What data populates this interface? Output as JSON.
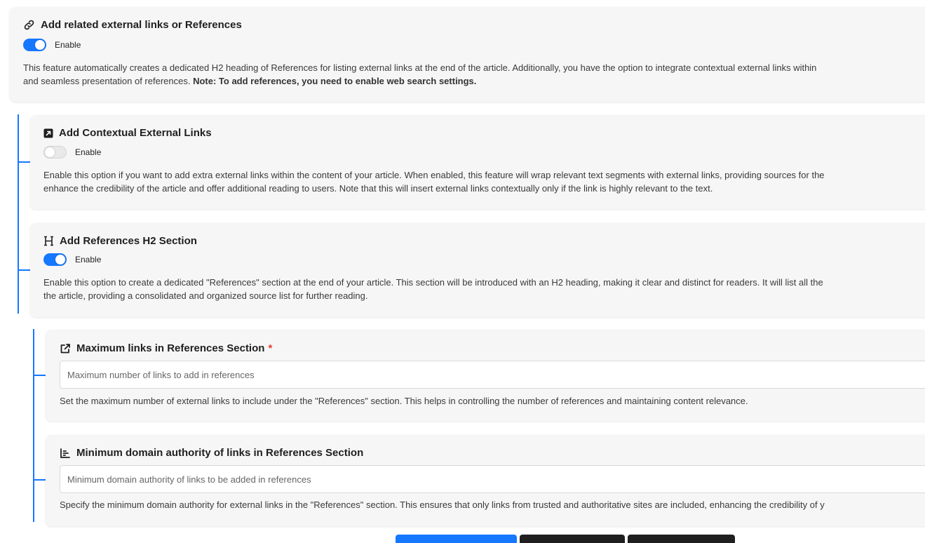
{
  "sections": {
    "external_links": {
      "title": "Add related external links or References",
      "toggle_label": "Enable",
      "enabled": true,
      "description": "This feature automatically creates a dedicated H2 heading of References for listing external links at the end of the article. Additionally, you have the option to integrate contextual external links within",
      "description_line2": "and seamless presentation of references.",
      "note": "Note: To add references, you need to enable web search settings."
    },
    "contextual": {
      "title": "Add Contextual External Links",
      "toggle_label": "Enable",
      "enabled": false,
      "description_line1": "Enable this option if you want to add extra external links within the content of your article. When enabled, this feature will wrap relevant text segments with external links, providing sources for the",
      "description_line2": "enhance the credibility of the article and offer additional reading to users. Note that this will insert external links contextually only if the link is highly relevant to the text."
    },
    "references_h2": {
      "title": "Add References H2 Section",
      "toggle_label": "Enable",
      "enabled": true,
      "description_line1": "Enable this option to create a dedicated \"References\" section at the end of your article. This section will be introduced with an H2 heading, making it clear and distinct for readers. It will list all the",
      "description_line2": "the article, providing a consolidated and organized source list for further reading."
    },
    "max_links": {
      "title": "Maximum links in References Section",
      "required_mark": "*",
      "placeholder": "Maximum number of links to add in references",
      "help": "Set the maximum number of external links to include under the \"References\" section. This helps in controlling the number of references and maintaining content relevance."
    },
    "min_authority": {
      "title": "Minimum domain authority of links in References Section",
      "placeholder": "Minimum domain authority of links to be added in references",
      "help": "Specify the minimum domain authority for external links in the \"References\" section. This ensures that only links from trusted and authoritative sites are included, enhancing the credibility of y"
    }
  },
  "colors": {
    "accent": "#1677ff",
    "dark_button": "#1f1f1f",
    "required": "#e53935"
  },
  "icons": [
    "link-icon",
    "external-square-icon",
    "heading-icon",
    "external-link-icon",
    "bar-chart-icon"
  ]
}
